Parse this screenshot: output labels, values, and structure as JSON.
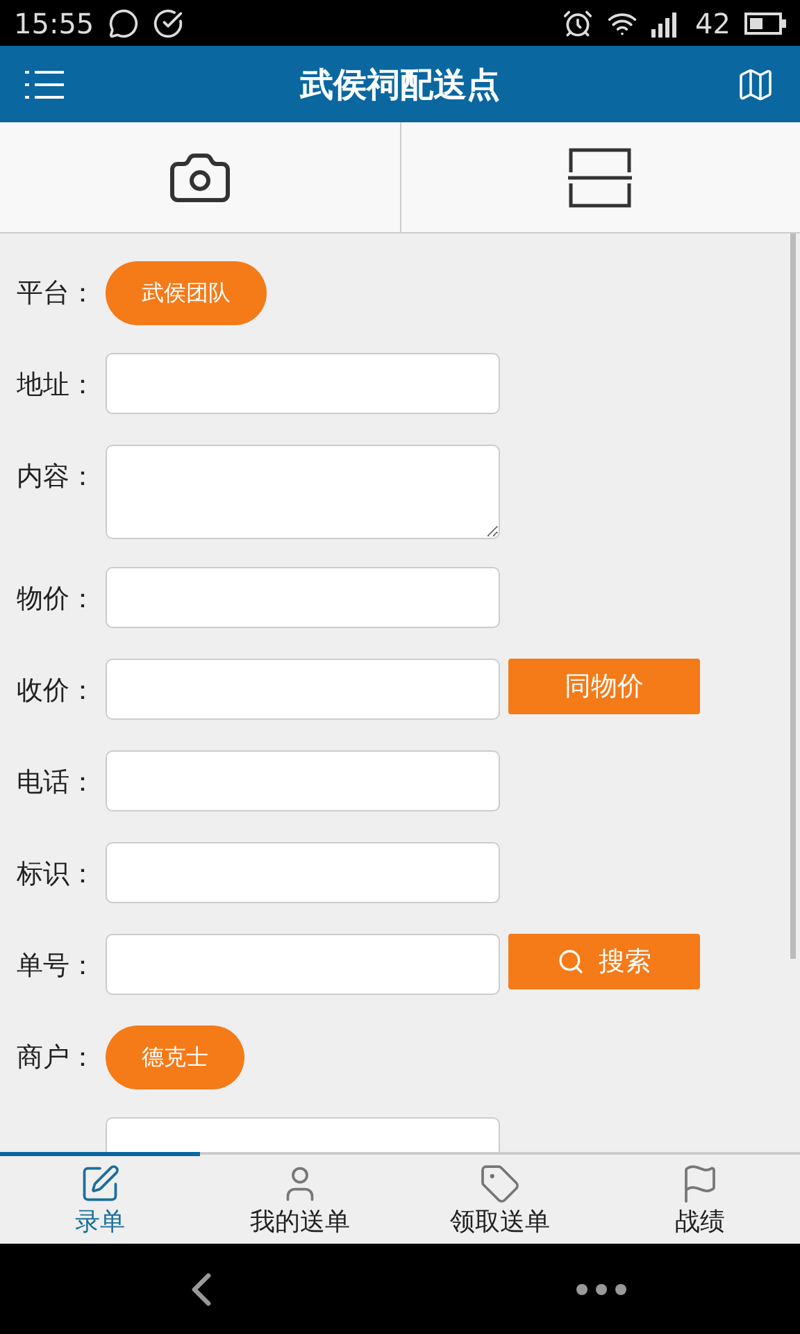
{
  "status_bar": {
    "time": "15:55",
    "battery": "42"
  },
  "header": {
    "title": "武侯祠配送点"
  },
  "form": {
    "rows": [
      {
        "kind": "chip",
        "label": "平台：",
        "value": "武侯团队"
      },
      {
        "kind": "field",
        "label": "地址："
      },
      {
        "kind": "textarea",
        "label": "内容："
      },
      {
        "kind": "field",
        "label": "物价："
      },
      {
        "kind": "field",
        "label": "收价：",
        "button": {
          "label": "同物价",
          "icon": false
        }
      },
      {
        "kind": "field",
        "label": "电话："
      },
      {
        "kind": "field",
        "label": "标识："
      },
      {
        "kind": "field",
        "label": "单号：",
        "button": {
          "label": "搜索",
          "icon": true
        }
      },
      {
        "kind": "chip",
        "label": "商户：",
        "value": "德克士"
      },
      {
        "kind": "field"
      }
    ]
  },
  "tabs": [
    {
      "label": "录单",
      "selected": true
    },
    {
      "label": "我的送单",
      "selected": false
    },
    {
      "label": "领取送单",
      "selected": false
    },
    {
      "label": "战绩",
      "selected": false
    }
  ]
}
